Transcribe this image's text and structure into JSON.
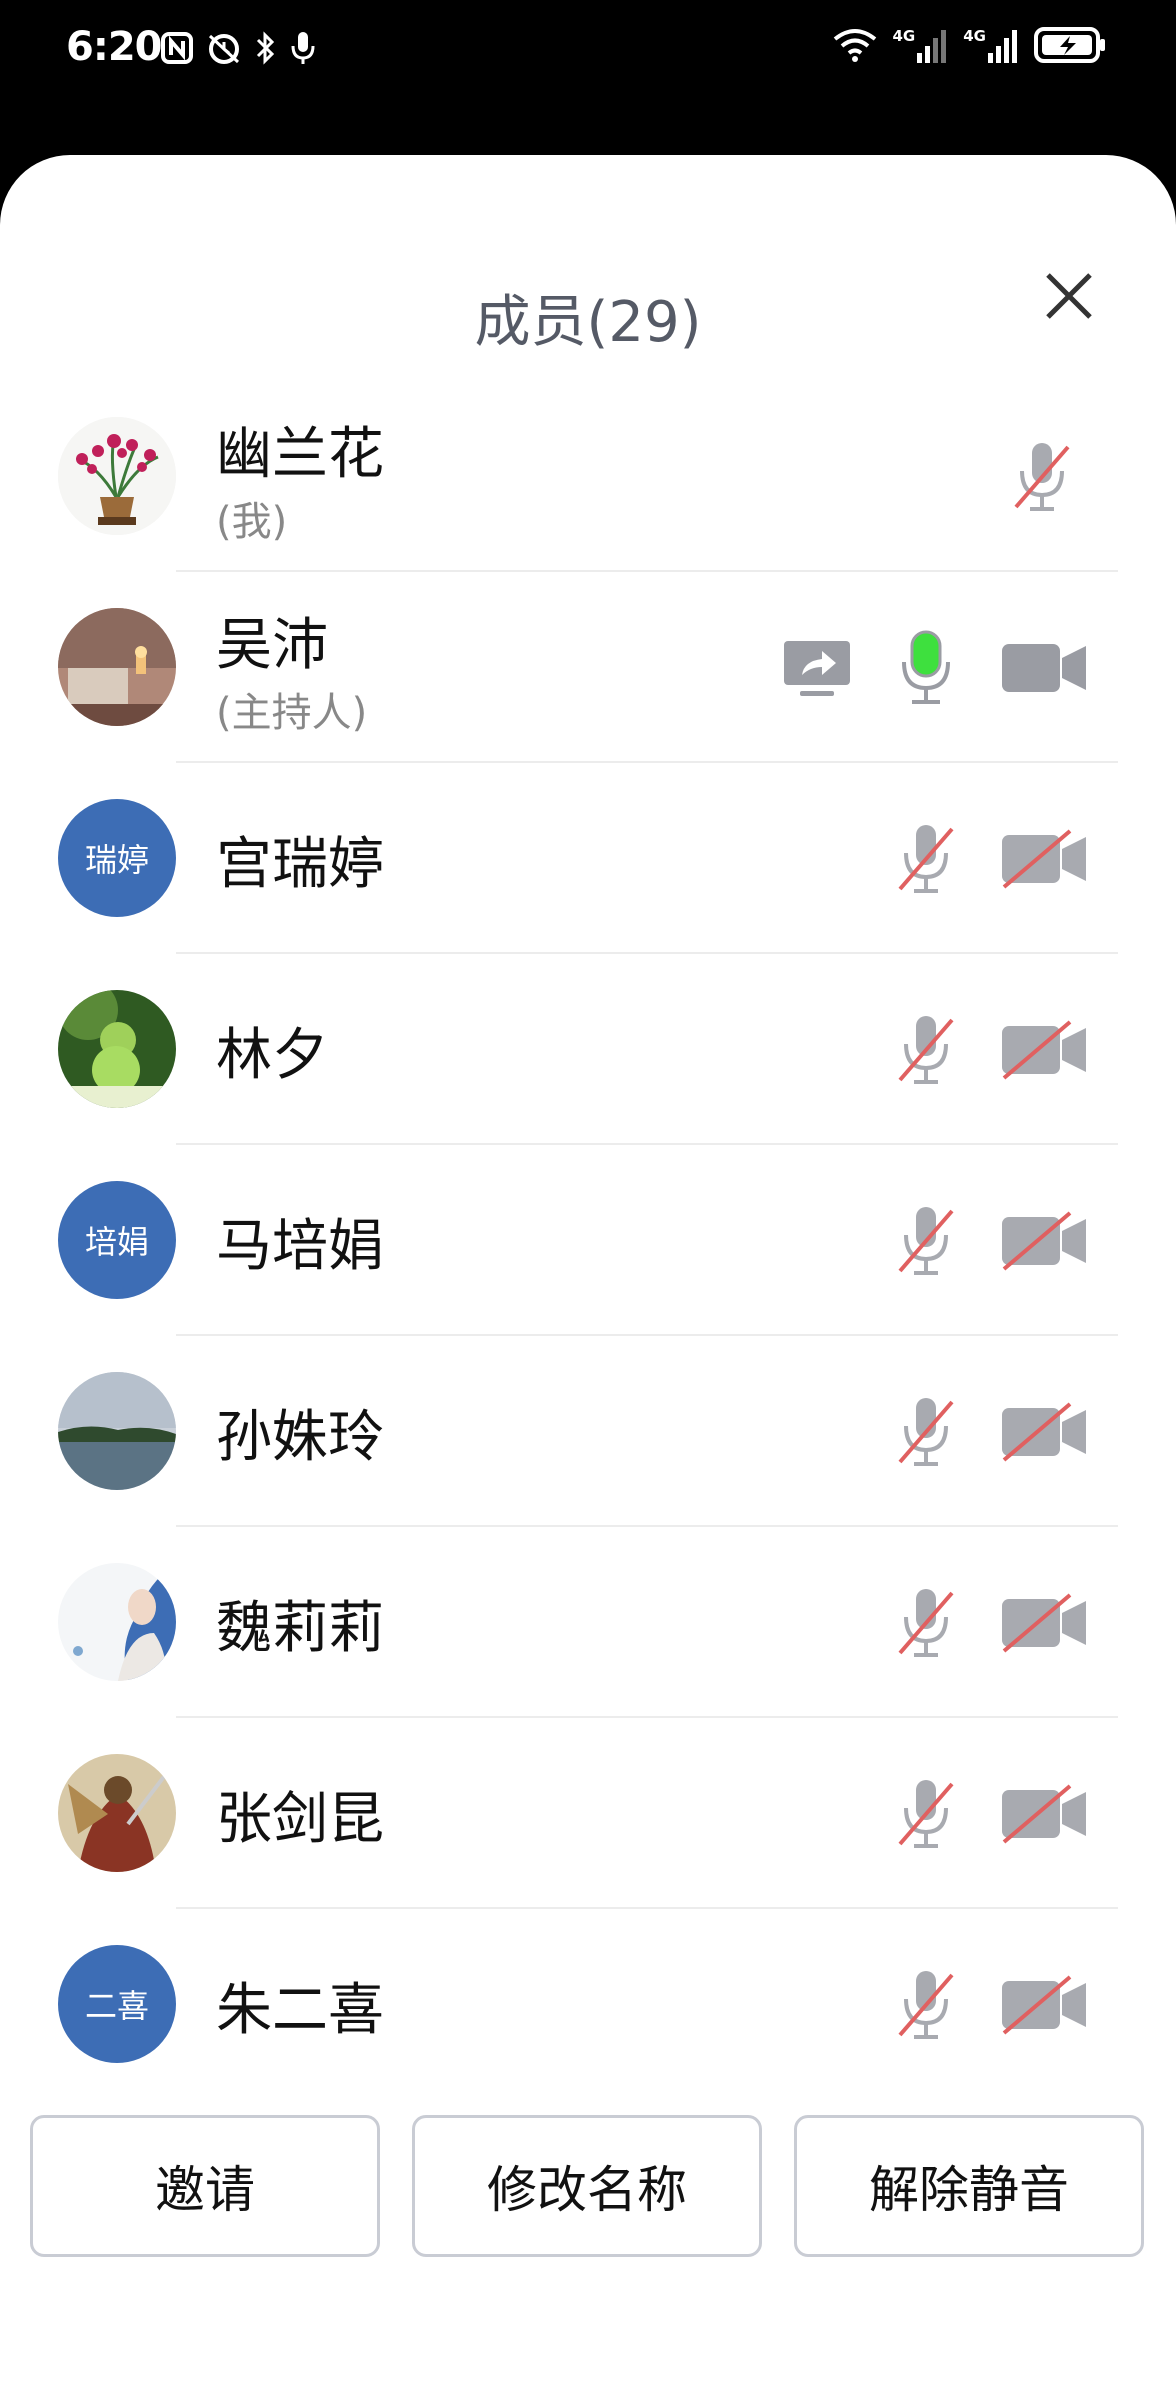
{
  "status_bar": {
    "time": "6:20",
    "left_icons": [
      "nfc-icon",
      "alarm-icon",
      "bluetooth-icon",
      "microphone-icon"
    ],
    "right_icons": [
      "wifi-icon",
      "signal-4g-icon",
      "signal-4g-icon",
      "battery-charging-icon"
    ],
    "signal_label_1": "4G",
    "signal_label_2": "4G"
  },
  "header": {
    "title": "成员(29)",
    "close_icon": "close-icon"
  },
  "members": [
    {
      "name": "幽兰花",
      "subtitle": "(我)",
      "avatar_type": "image-orchid",
      "mic": "muted",
      "camera": "none",
      "screen_share": false
    },
    {
      "name": "吴沛",
      "subtitle": "(主持人)",
      "avatar_type": "image-room",
      "mic": "active",
      "camera": "on",
      "screen_share": true
    },
    {
      "name": "宫瑞婷",
      "avatar_text": "瑞婷",
      "avatar_type": "text",
      "mic": "muted",
      "camera": "off",
      "screen_share": false
    },
    {
      "name": "林夕",
      "avatar_type": "image-gourd",
      "mic": "muted",
      "camera": "off",
      "screen_share": false
    },
    {
      "name": "马培娟",
      "avatar_text": "培娟",
      "avatar_type": "text",
      "mic": "muted",
      "camera": "off",
      "screen_share": false
    },
    {
      "name": "孙姝玲",
      "avatar_type": "image-lake",
      "mic": "muted",
      "camera": "off",
      "screen_share": false
    },
    {
      "name": "魏莉莉",
      "avatar_type": "image-woman",
      "mic": "muted",
      "camera": "off",
      "screen_share": false
    },
    {
      "name": "张剑昆",
      "avatar_type": "image-warrior",
      "mic": "muted",
      "camera": "off",
      "screen_share": false
    },
    {
      "name": "朱二喜",
      "avatar_text": "二喜",
      "avatar_type": "text",
      "mic": "muted",
      "camera": "off",
      "screen_share": false
    }
  ],
  "footer": {
    "invite_label": "邀请",
    "rename_label": "修改名称",
    "unmute_label": "解除静音"
  },
  "colors": {
    "accent_blue": "#3d6db5",
    "muted_red": "#e06060",
    "icon_gray": "#9a9ca3",
    "mic_active_green": "#3ee03e",
    "title_gray": "#555a66"
  }
}
